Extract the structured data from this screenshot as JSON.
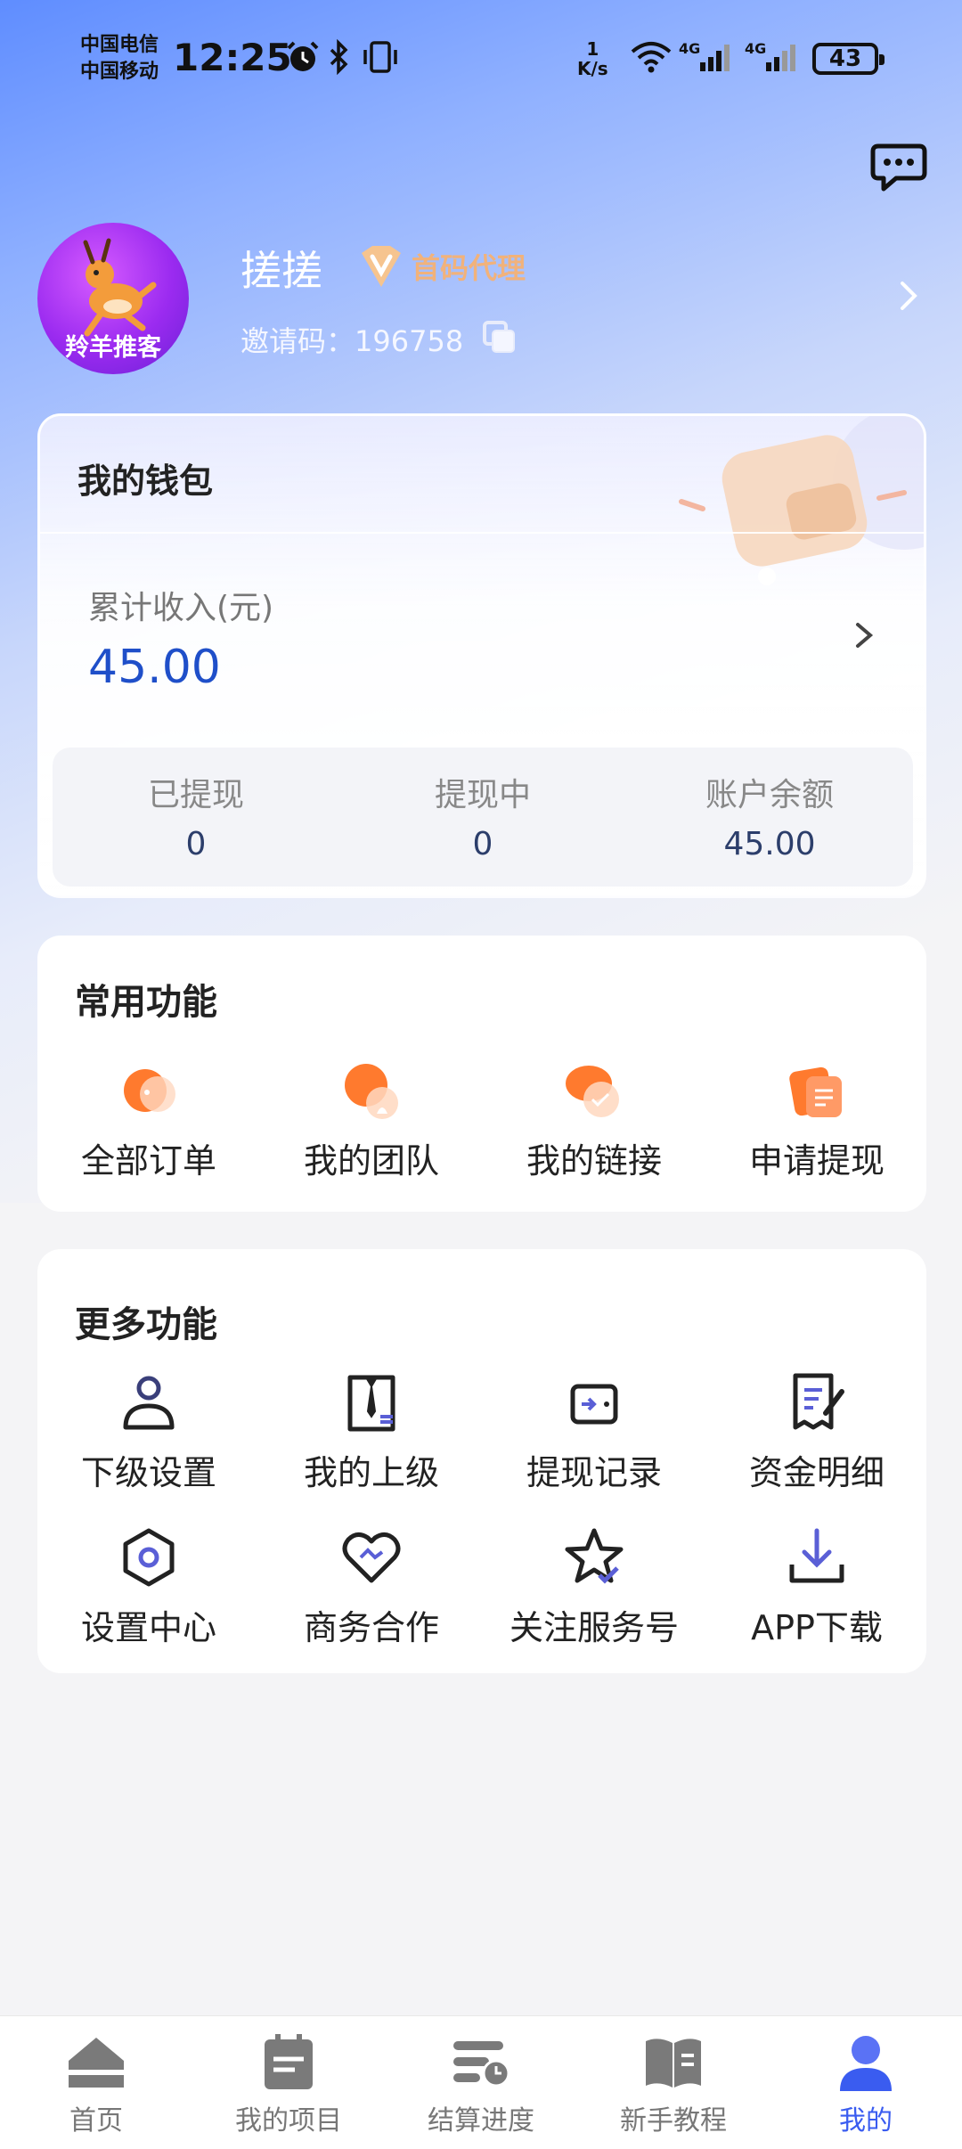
{
  "status_bar": {
    "carrier_1": "中国电信",
    "carrier_2": "中国移动",
    "time": "12:25",
    "net_speed_value": "1",
    "net_speed_unit": "K/s",
    "battery": "43"
  },
  "profile": {
    "avatar_text": "羚羊推客",
    "username": "搓搓",
    "badge": "首码代理",
    "invite_label": "邀请码：",
    "invite_code": "196758"
  },
  "wallet": {
    "title": "我的钱包",
    "income_label": "累计收入(元)",
    "income_value": "45.00",
    "stats": [
      {
        "label": "已提现",
        "value": "0"
      },
      {
        "label": "提现中",
        "value": "0"
      },
      {
        "label": "账户余额",
        "value": "45.00"
      }
    ]
  },
  "common": {
    "title": "常用功能",
    "items": [
      {
        "label": "全部订单",
        "icon": "orders-icon"
      },
      {
        "label": "我的团队",
        "icon": "team-icon"
      },
      {
        "label": "我的链接",
        "icon": "link-icon"
      },
      {
        "label": "申请提现",
        "icon": "withdraw-icon"
      }
    ]
  },
  "more": {
    "title": "更多功能",
    "items": [
      {
        "label": "下级设置",
        "icon": "user-icon"
      },
      {
        "label": "我的上级",
        "icon": "superior-icon"
      },
      {
        "label": "提现记录",
        "icon": "wallet-icon"
      },
      {
        "label": "资金明细",
        "icon": "document-edit-icon"
      },
      {
        "label": "设置中心",
        "icon": "settings-hexagon-icon"
      },
      {
        "label": "商务合作",
        "icon": "handshake-heart-icon"
      },
      {
        "label": "关注服务号",
        "icon": "star-check-icon"
      },
      {
        "label": "APP下载",
        "icon": "download-icon"
      }
    ]
  },
  "nav": {
    "items": [
      {
        "label": "首页",
        "icon": "home-icon"
      },
      {
        "label": "我的项目",
        "icon": "project-icon"
      },
      {
        "label": "结算进度",
        "icon": "settlement-icon"
      },
      {
        "label": "新手教程",
        "icon": "book-icon"
      },
      {
        "label": "我的",
        "icon": "profile-icon"
      }
    ],
    "active": "我的"
  },
  "colors": {
    "accent": "#3a5cf0",
    "income": "#1f4fc9",
    "icon_blue": "#3f3f8f",
    "icon_orange": "#ff7a2e"
  }
}
